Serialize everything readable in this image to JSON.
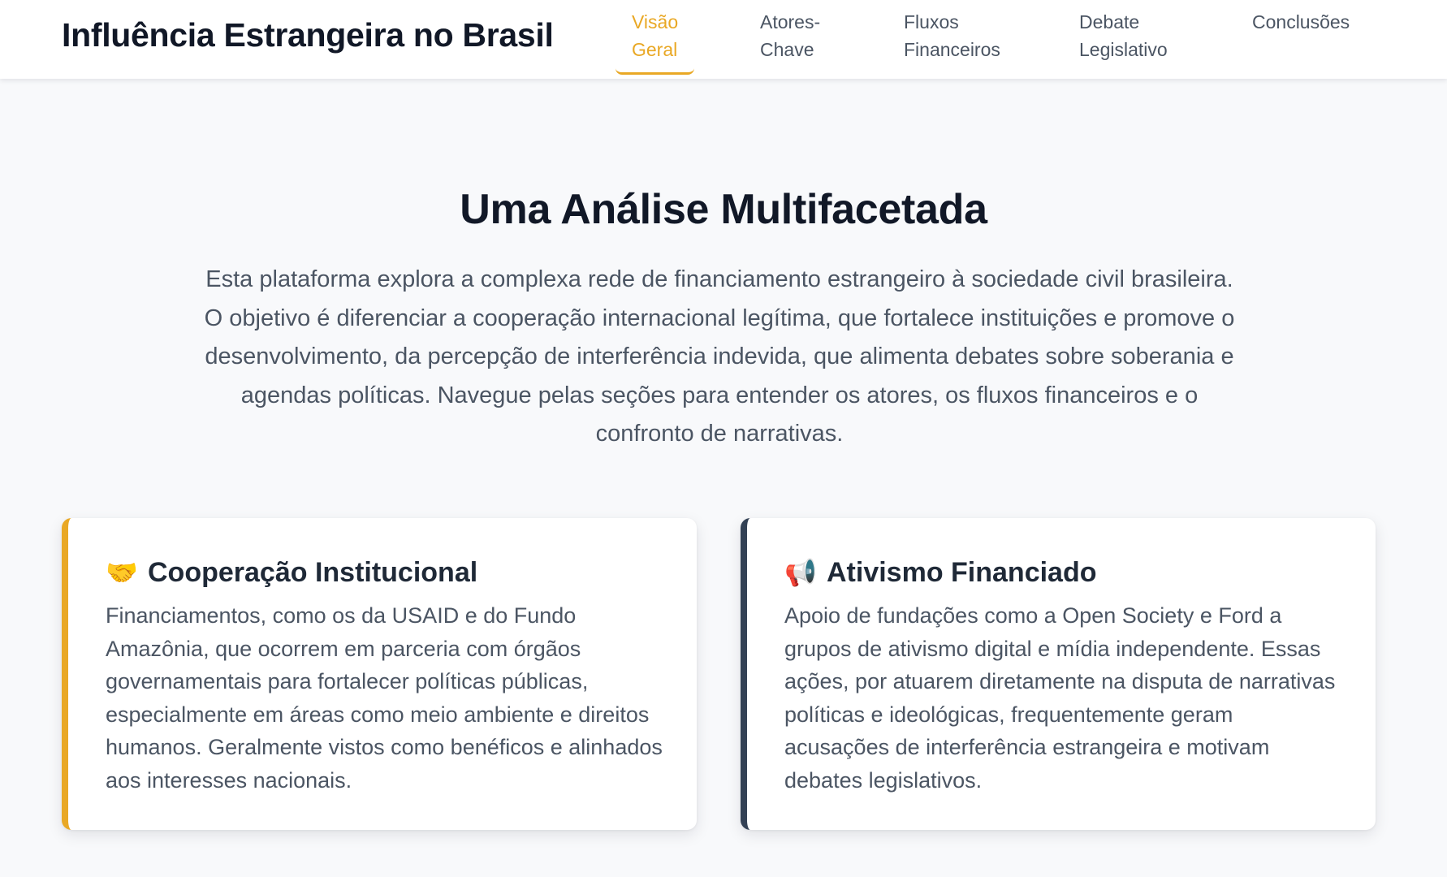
{
  "header": {
    "title": "Influência Estrangeira no Brasil",
    "nav": [
      {
        "line1": "Visão",
        "line2": "Geral"
      },
      {
        "line1": "Atores-",
        "line2": "Chave"
      },
      {
        "line1": "Fluxos",
        "line2": "Financeiros"
      },
      {
        "line1": "Debate",
        "line2": "Legislativo"
      },
      {
        "line1": "Conclusões",
        "line2": ""
      }
    ],
    "active_tab": "Visão Geral"
  },
  "hero": {
    "title": "Uma Análise Multifacetada",
    "description": "Esta plataforma explora a complexa rede de financiamento estrangeiro à sociedade civil brasileira. O objetivo é diferenciar a cooperação internacional legítima, que fortalece instituições e promove o desenvolvimento, da percepção de interferência indevida, que alimenta debates sobre soberania e agendas políticas. Navegue pelas seções para entender os atores, os fluxos financeiros e o confronto de narrativas."
  },
  "cards": [
    {
      "icon": "🤝",
      "icon_name": "handshake-icon",
      "title": "Cooperação Institucional",
      "text": "Financiamentos, como os da USAID e do Fundo Amazônia, que ocorrem em parceria com órgãos governamentais para fortalecer políticas públicas, especialmente em áreas como meio ambiente e direitos humanos. Geralmente vistos como benéficos e alinhados aos interesses nacionais.",
      "accent": "#e9a825"
    },
    {
      "icon": "📢",
      "icon_name": "megaphone-icon",
      "title": "Ativismo Financiado",
      "text": "Apoio de fundações como a Open Society e Ford a grupos de ativismo digital e mídia independente. Essas ações, por atuarem diretamente na disputa de narrativas políticas e ideológicas, frequentemente geram acusações de interferência estrangeira e motivam debates legislativos.",
      "accent": "#334155"
    }
  ],
  "colors": {
    "accent": "#e9a825",
    "dark_accent": "#334155",
    "background": "#f8f9fb",
    "text_primary": "#111827",
    "text_secondary": "#4b5563"
  }
}
